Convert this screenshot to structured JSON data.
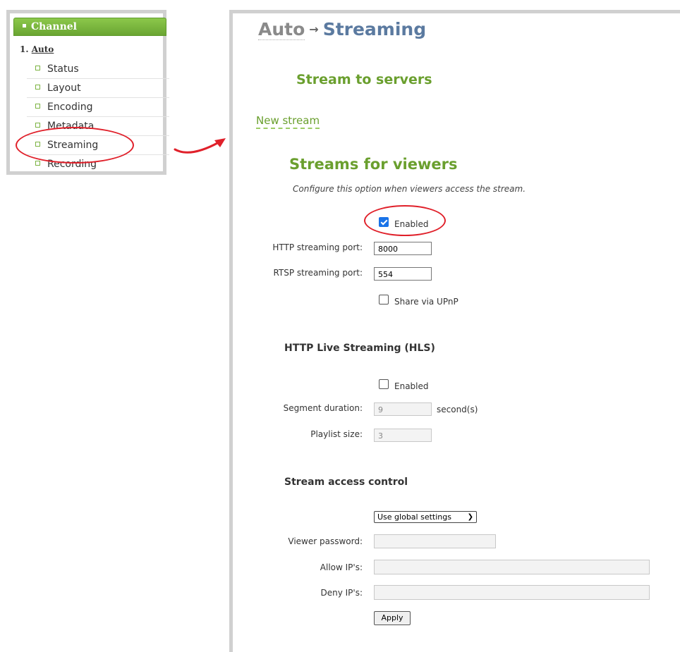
{
  "sidebar": {
    "header": "Channel",
    "channel_number": "1.",
    "channel_name": "Auto",
    "items": [
      {
        "label": "Status"
      },
      {
        "label": "Layout"
      },
      {
        "label": "Encoding"
      },
      {
        "label": "Metadata"
      },
      {
        "label": "Streaming"
      },
      {
        "label": "Recording"
      }
    ]
  },
  "breadcrumb": {
    "parent": "Auto",
    "separator": "→",
    "current": "Streaming"
  },
  "stream_to_servers": {
    "heading": "Stream to servers",
    "new_stream_link": "New stream"
  },
  "streams_for_viewers": {
    "heading": "Streams for viewers",
    "note": "Configure this option when viewers access the stream.",
    "enabled_label": "Enabled",
    "enabled_checked": true,
    "http_port_label": "HTTP streaming port:",
    "http_port_value": "8000",
    "rtsp_port_label": "RTSP streaming port:",
    "rtsp_port_value": "554",
    "upnp_label": "Share via UPnP",
    "upnp_checked": false
  },
  "hls": {
    "heading": "HTTP Live Streaming (HLS)",
    "enabled_label": "Enabled",
    "enabled_checked": false,
    "segment_label": "Segment duration:",
    "segment_value": "9",
    "segment_unit": "second(s)",
    "playlist_label": "Playlist size:",
    "playlist_value": "3"
  },
  "access_control": {
    "heading": "Stream access control",
    "mode_selected": "Use global settings",
    "viewer_password_label": "Viewer password:",
    "viewer_password_value": "",
    "allow_label": "Allow IP's:",
    "allow_value": "",
    "deny_label": "Deny IP's:",
    "deny_value": "",
    "apply_label": "Apply"
  },
  "colors": {
    "accent_green": "#6a9f2e",
    "annotation_red": "#e0202a",
    "title_blue": "#5b7aa0"
  }
}
